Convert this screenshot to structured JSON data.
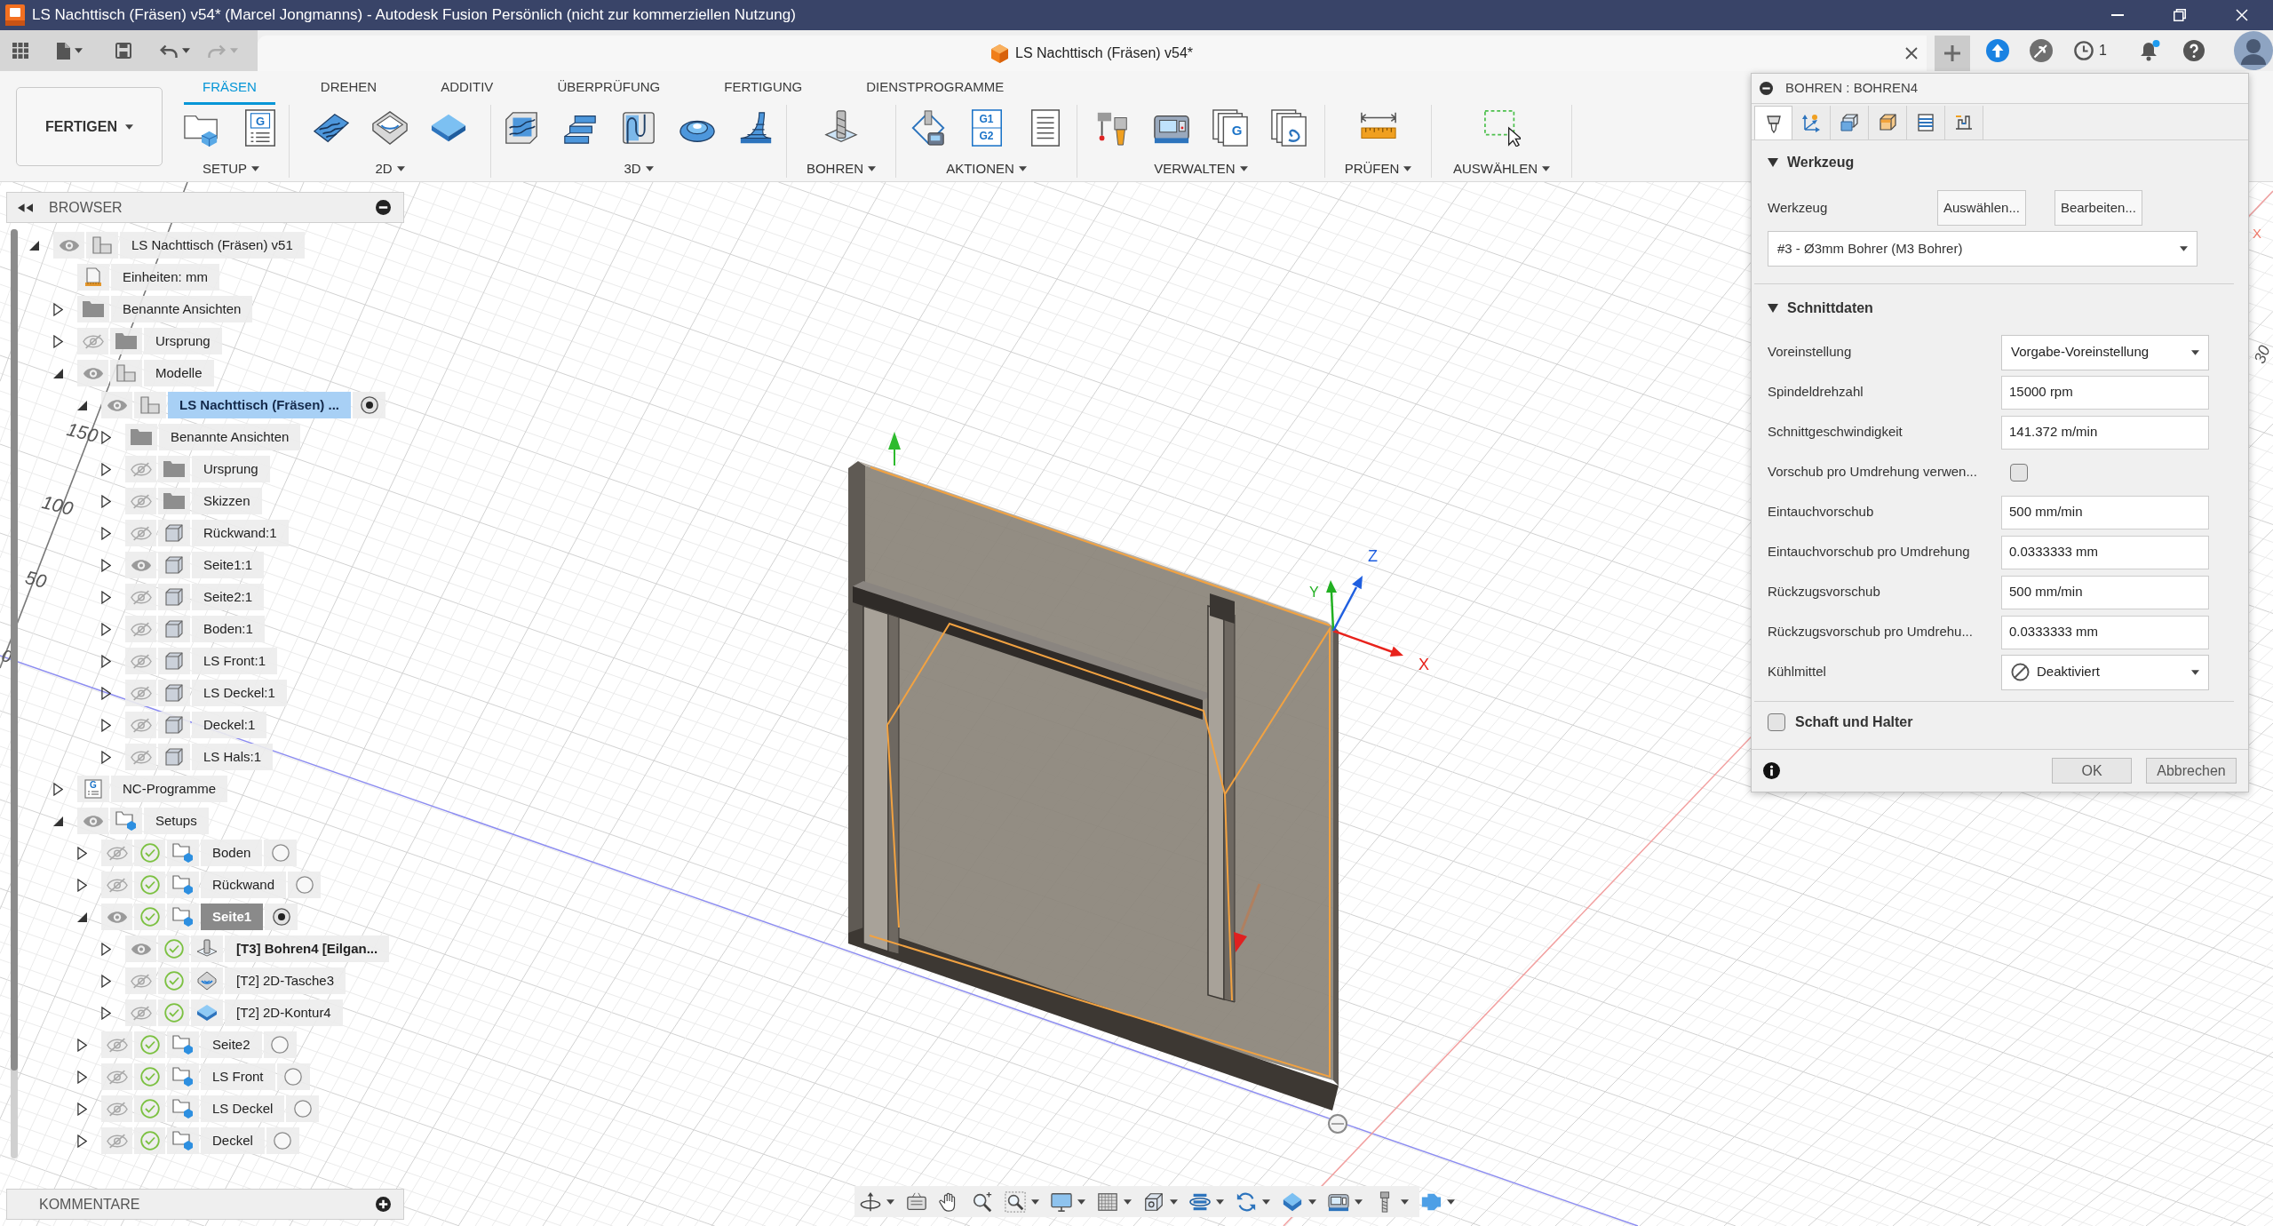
{
  "window": {
    "title": "LS Nachttisch (Fräsen) v54* (Marcel Jongmanns) - Autodesk Fusion Persönlich (nicht zur kommerziellen Nutzung)"
  },
  "app_bar": {
    "document_tab": "LS Nachttisch (Fräsen) v54*",
    "job_count": "1"
  },
  "ribbon": {
    "workspace": "FERTIGEN",
    "tabs": [
      {
        "label": "FRÄSEN",
        "selected": true
      },
      {
        "label": "DREHEN",
        "selected": false
      },
      {
        "label": "ADDITIV",
        "selected": false
      },
      {
        "label": "ÜBERPRÜFUNG",
        "selected": false
      },
      {
        "label": "FERTIGUNG",
        "selected": false
      },
      {
        "label": "DIENSTPROGRAMME",
        "selected": false
      }
    ],
    "groups": [
      {
        "label": "SETUP",
        "tools": [
          {
            "kind": "setup"
          },
          {
            "kind": "program",
            "text": "G"
          }
        ]
      },
      {
        "label": "2D",
        "tools": [
          {
            "kind": "adaptive"
          },
          {
            "kind": "pocket"
          },
          {
            "kind": "contour"
          }
        ]
      },
      {
        "label": "3D",
        "tools": [
          {
            "kind": "clearing"
          },
          {
            "kind": "steep"
          },
          {
            "kind": "flow"
          },
          {
            "kind": "dome"
          },
          {
            "kind": "ramp"
          }
        ]
      },
      {
        "label": "BOHREN",
        "tools": [
          {
            "kind": "drill"
          }
        ]
      },
      {
        "label": "AKTIONEN",
        "tools": [
          {
            "kind": "simulate"
          },
          {
            "kind": "post",
            "text": "G1 G2"
          },
          {
            "kind": "sheet"
          }
        ]
      },
      {
        "label": "VERWALTEN",
        "tools": [
          {
            "kind": "library"
          },
          {
            "kind": "machine"
          },
          {
            "kind": "gdoc",
            "text": "G"
          },
          {
            "kind": "templates"
          }
        ]
      },
      {
        "label": "PRÜFEN",
        "tools": [
          {
            "kind": "measure"
          }
        ]
      },
      {
        "label": "AUSWÄHLEN",
        "tools": [
          {
            "kind": "select"
          }
        ]
      }
    ]
  },
  "browser": {
    "title": "BROWSER",
    "tree": [
      {
        "label": "LS Nachttisch (Fräsen) v51",
        "kind": "component",
        "expanded": true,
        "visible": true,
        "selected": false,
        "children": [
          {
            "label": "Einheiten: mm",
            "kind": "units",
            "selected": false
          },
          {
            "label": "Benannte Ansichten",
            "kind": "folder",
            "expanded": false,
            "selected": false
          },
          {
            "label": "Ursprung",
            "kind": "folder",
            "expanded": false,
            "visible": false,
            "selected": false
          },
          {
            "label": "Modelle",
            "kind": "component",
            "expanded": true,
            "visible": true,
            "selected": false,
            "children": [
              {
                "label": "LS Nachttisch (Fräsen) ...",
                "kind": "component",
                "expanded": true,
                "visible": true,
                "selected": true,
                "active": true,
                "children": [
                  {
                    "label": "Benannte Ansichten",
                    "kind": "folder",
                    "expanded": false,
                    "selected": false
                  },
                  {
                    "label": "Ursprung",
                    "kind": "folder",
                    "expanded": false,
                    "visible": false,
                    "selected": false
                  },
                  {
                    "label": "Skizzen",
                    "kind": "folder",
                    "expanded": false,
                    "visible": false,
                    "selected": false
                  },
                  {
                    "label": "Rückwand:1",
                    "kind": "body",
                    "expanded": false,
                    "visible": false,
                    "selected": false
                  },
                  {
                    "label": "Seite1:1",
                    "kind": "body",
                    "expanded": false,
                    "visible": true,
                    "selected": false
                  },
                  {
                    "label": "Seite2:1",
                    "kind": "body",
                    "expanded": false,
                    "visible": false,
                    "selected": false
                  },
                  {
                    "label": "Boden:1",
                    "kind": "body",
                    "expanded": false,
                    "visible": false,
                    "selected": false
                  },
                  {
                    "label": "LS Front:1",
                    "kind": "body",
                    "expanded": false,
                    "visible": false,
                    "selected": false
                  },
                  {
                    "label": "LS Deckel:1",
                    "kind": "body",
                    "expanded": false,
                    "visible": false,
                    "selected": false
                  },
                  {
                    "label": "Deckel:1",
                    "kind": "body",
                    "expanded": false,
                    "visible": false,
                    "selected": false
                  },
                  {
                    "label": "LS Hals:1",
                    "kind": "body",
                    "expanded": false,
                    "visible": false,
                    "selected": false
                  }
                ]
              }
            ]
          },
          {
            "label": "NC-Programme",
            "kind": "programs",
            "icon_text": "G",
            "expanded": false,
            "selected": false
          },
          {
            "label": "Setups",
            "kind": "setup",
            "expanded": true,
            "visible": true,
            "selected": false,
            "children": [
              {
                "label": "Boden",
                "kind": "setup",
                "expanded": false,
                "visible": false,
                "generated": true,
                "active": false,
                "selected": false
              },
              {
                "label": "Rückwand",
                "kind": "setup",
                "expanded": false,
                "visible": false,
                "generated": true,
                "active": false,
                "selected": false
              },
              {
                "label": "Seite1",
                "kind": "setup",
                "expanded": true,
                "visible": true,
                "generated": true,
                "active": true,
                "selected": false,
                "children": [
                  {
                    "label": "[T3] Bohren4 [Eilgan...",
                    "kind": "drill",
                    "expanded": false,
                    "visible": true,
                    "generated": true,
                    "editing": true,
                    "selected": false
                  },
                  {
                    "label": "[T2] 2D-Tasche3",
                    "kind": "pocket",
                    "expanded": false,
                    "visible": false,
                    "generated": true,
                    "selected": false
                  },
                  {
                    "label": "[T2] 2D-Kontur4",
                    "kind": "contour",
                    "expanded": false,
                    "visible": false,
                    "generated": true,
                    "selected": false
                  }
                ]
              },
              {
                "label": "Seite2",
                "kind": "setup",
                "expanded": false,
                "visible": false,
                "generated": true,
                "active": false,
                "selected": false
              },
              {
                "label": "LS Front",
                "kind": "setup",
                "expanded": false,
                "visible": false,
                "generated": true,
                "active": false,
                "selected": false
              },
              {
                "label": "LS Deckel",
                "kind": "setup",
                "expanded": false,
                "visible": false,
                "generated": true,
                "active": false,
                "selected": false
              },
              {
                "label": "Deckel",
                "kind": "setup",
                "expanded": false,
                "visible": false,
                "generated": true,
                "active": false,
                "selected": false
              }
            ]
          }
        ]
      }
    ]
  },
  "comments": {
    "title": "KOMMENTARE"
  },
  "viewport": {
    "axis_labels": [
      {
        "text": "Z",
        "color": "#1f5fe0"
      },
      {
        "text": "Y",
        "color": "#22b022"
      },
      {
        "text": "X",
        "color": "#e8231c"
      },
      {
        "text": "X",
        "color": "#f07a6a"
      }
    ],
    "ruler_labels": [
      "150",
      "100",
      "50",
      "0",
      "30"
    ]
  },
  "dialog": {
    "title": "BOHREN : BOHREN4",
    "tabs": [
      {
        "selected": true
      },
      {
        "selected": false
      },
      {
        "selected": false
      },
      {
        "selected": false
      },
      {
        "selected": false
      },
      {
        "selected": false
      }
    ],
    "tool_section": {
      "title": "Werkzeug",
      "expanded": true,
      "label": "Werkzeug",
      "buttons": [
        "Auswählen...",
        "Bearbeiten..."
      ],
      "tool": "#3 - Ø3mm Bohrer (M3 Bohrer)"
    },
    "feeds_section": {
      "title": "Schnittdaten",
      "expanded": true,
      "rows": [
        {
          "kind": "select",
          "label": "Voreinstellung",
          "value": "Vorgabe-Voreinstellung"
        },
        {
          "kind": "input",
          "label": "Spindeldrehzahl",
          "value": "15000 rpm"
        },
        {
          "kind": "input",
          "label": "Schnittgeschwindigkeit",
          "value": "141.372 m/min"
        },
        {
          "kind": "checkbox",
          "label": "Vorschub pro Umdrehung verwen...",
          "checked": false
        },
        {
          "kind": "input",
          "label": "Eintauchvorschub",
          "value": "500 mm/min"
        },
        {
          "kind": "input",
          "label": "Eintauchvorschub pro Umdrehung",
          "value": "0.0333333 mm"
        },
        {
          "kind": "input",
          "label": "Rückzugsvorschub",
          "value": "500 mm/min"
        },
        {
          "kind": "input",
          "label": "Rückzugsvorschub pro Umdrehu...",
          "value": "0.0333333 mm"
        },
        {
          "kind": "coolant",
          "label": "Kühlmittel",
          "value": "Deaktiviert"
        }
      ]
    },
    "holder_section": {
      "title": "Schaft und Halter",
      "checked": false
    },
    "buttons": [
      "OK",
      "Abbrechen"
    ]
  }
}
